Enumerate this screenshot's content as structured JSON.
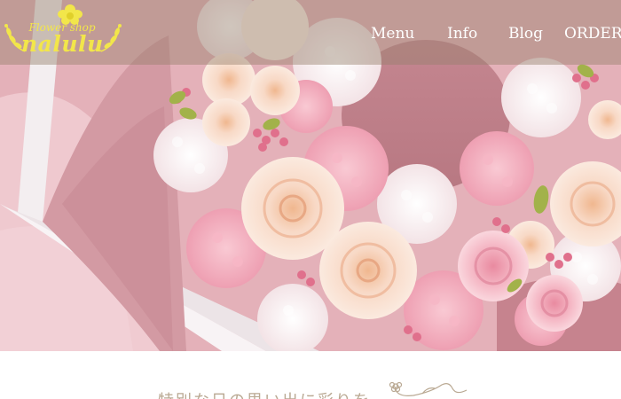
{
  "logo": {
    "small_text": "Flower shop",
    "big_text": "nalulu"
  },
  "nav": {
    "items": [
      {
        "label": "Menu"
      },
      {
        "label": "Info"
      },
      {
        "label": "Blog"
      },
      {
        "label": "ORDER"
      }
    ]
  },
  "main": {
    "tagline": "特別な日の思い出に彩りを"
  },
  "colors": {
    "logo_yellow": "#f2e64a",
    "header_overlay": "#96806c",
    "tagline_beige": "#b9a892",
    "rose_peach": "#f6d3bd",
    "rose_pink": "#f0a9b9",
    "box_white": "#f3eef0"
  },
  "icons": {
    "logo_flower": "flower-icon",
    "logo_leaves": "laurel-icon",
    "tagline_deco": "flower-swirl-icon"
  }
}
